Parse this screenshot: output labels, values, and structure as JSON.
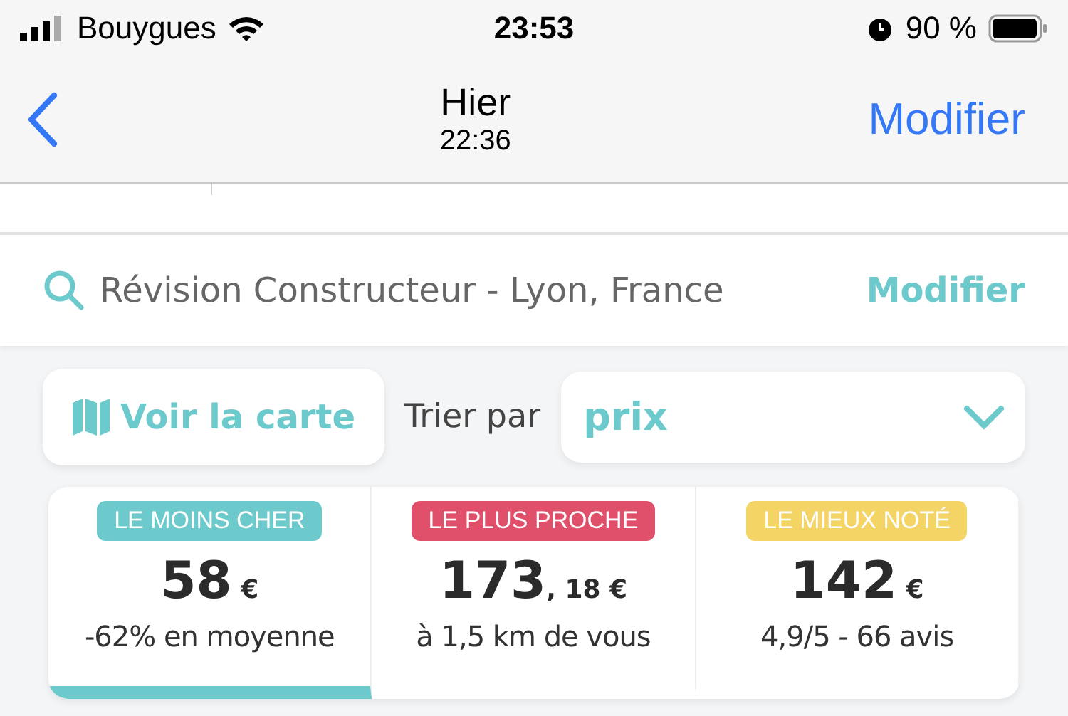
{
  "status_bar": {
    "carrier": "Bouygues",
    "time": "23:53",
    "battery": "90 %"
  },
  "nav": {
    "title": "Hier",
    "subtitle": "22:36",
    "action": "Modifier"
  },
  "search": {
    "query": "Révision Constructeur - Lyon, France",
    "action": "Modifier"
  },
  "map_button": "Voir la carte",
  "sort": {
    "label": "Trier par",
    "value": "prix"
  },
  "offers": [
    {
      "tag": "LE MOINS CHER",
      "color": "#6cc9cc",
      "price": "58",
      "currency": "€",
      "detail": "-62% en moyenne",
      "selected": true
    },
    {
      "tag": "LE PLUS PROCHE",
      "color": "#e0506b",
      "price": "173",
      "cents": ", 18",
      "currency": "€",
      "detail": "à 1,5 km de vous",
      "selected": false
    },
    {
      "tag": "LE MIEUX NOTÉ",
      "color": "#f3d465",
      "price": "142",
      "currency": "€",
      "detail": "4,9/5 - 66 avis",
      "selected": false
    }
  ]
}
